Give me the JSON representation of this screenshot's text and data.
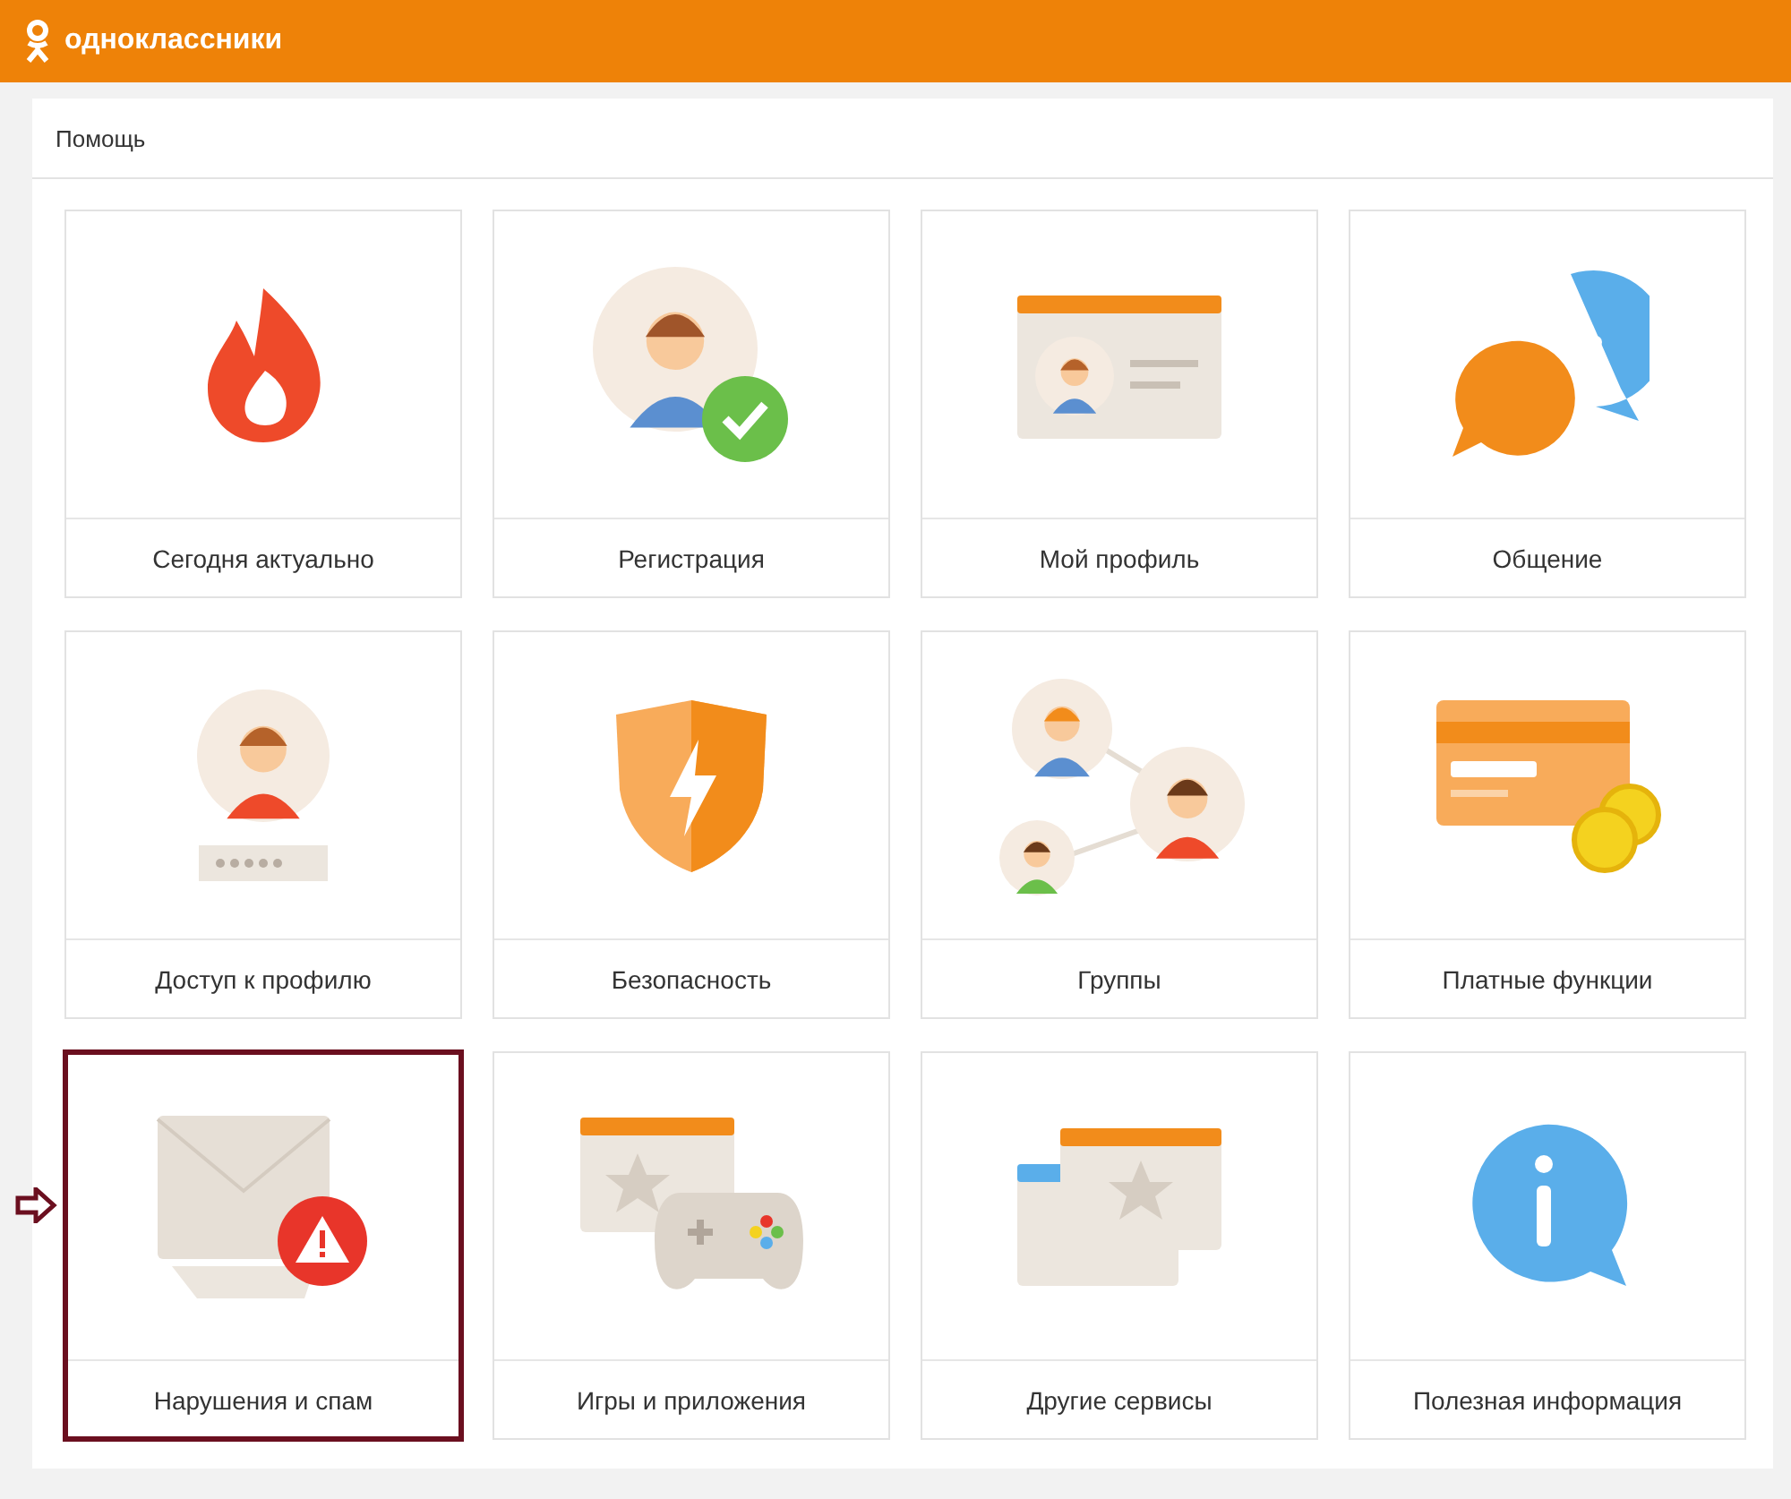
{
  "header": {
    "site_name": "одноклассники"
  },
  "page": {
    "title": "Помощь"
  },
  "sections": [
    {
      "label": "Сегодня актуально",
      "selected": false
    },
    {
      "label": "Регистрация",
      "selected": false
    },
    {
      "label": "Мой профиль",
      "selected": false
    },
    {
      "label": "Общение",
      "selected": false
    },
    {
      "label": "Доступ к профилю",
      "selected": false
    },
    {
      "label": "Безопасность",
      "selected": false
    },
    {
      "label": "Группы",
      "selected": false
    },
    {
      "label": "Платные функции",
      "selected": false
    },
    {
      "label": "Нарушения и спам",
      "selected": true
    },
    {
      "label": "Игры и приложения",
      "selected": false
    },
    {
      "label": "Другие сервисы",
      "selected": false
    },
    {
      "label": "Полезная информация",
      "selected": false
    }
  ]
}
